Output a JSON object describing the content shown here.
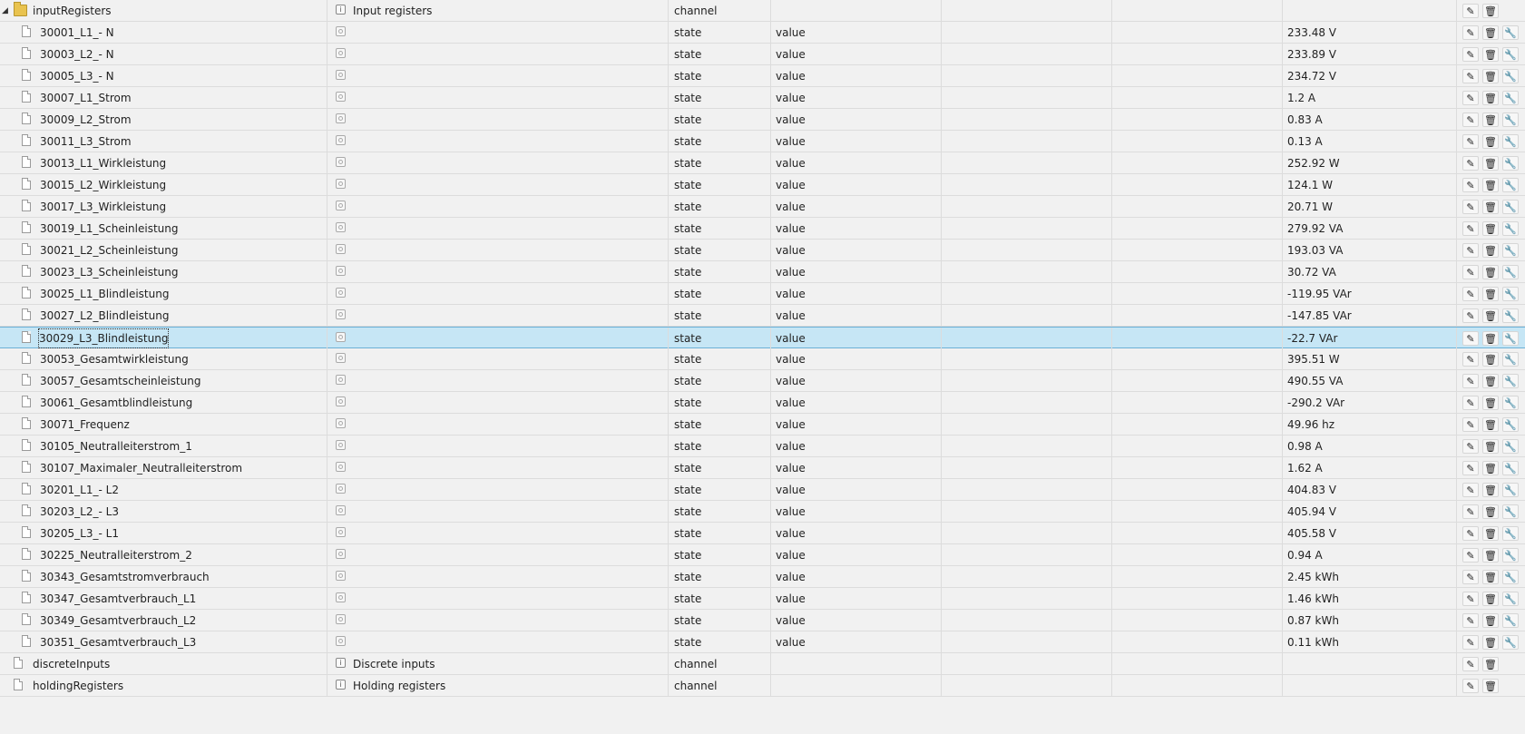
{
  "folder": {
    "name": "inputRegisters",
    "desc": "Input registers",
    "type": "channel"
  },
  "rows": [
    {
      "name": "30001_L1_- N",
      "type": "state",
      "role": "value",
      "val": "233.48 V"
    },
    {
      "name": "30003_L2_- N",
      "type": "state",
      "role": "value",
      "val": "233.89 V"
    },
    {
      "name": "30005_L3_- N",
      "type": "state",
      "role": "value",
      "val": "234.72 V"
    },
    {
      "name": "30007_L1_Strom",
      "type": "state",
      "role": "value",
      "val": "1.2 A"
    },
    {
      "name": "30009_L2_Strom",
      "type": "state",
      "role": "value",
      "val": "0.83 A"
    },
    {
      "name": "30011_L3_Strom",
      "type": "state",
      "role": "value",
      "val": "0.13 A"
    },
    {
      "name": "30013_L1_Wirkleistung",
      "type": "state",
      "role": "value",
      "val": "252.92 W"
    },
    {
      "name": "30015_L2_Wirkleistung",
      "type": "state",
      "role": "value",
      "val": "124.1 W"
    },
    {
      "name": "30017_L3_Wirkleistung",
      "type": "state",
      "role": "value",
      "val": "20.71 W"
    },
    {
      "name": "30019_L1_Scheinleistung",
      "type": "state",
      "role": "value",
      "val": "279.92 VA"
    },
    {
      "name": "30021_L2_Scheinleistung",
      "type": "state",
      "role": "value",
      "val": "193.03 VA"
    },
    {
      "name": "30023_L3_Scheinleistung",
      "type": "state",
      "role": "value",
      "val": "30.72 VA"
    },
    {
      "name": "30025_L1_Blindleistung",
      "type": "state",
      "role": "value",
      "val": "-119.95 VAr"
    },
    {
      "name": "30027_L2_Blindleistung",
      "type": "state",
      "role": "value",
      "val": "-147.85 VAr"
    },
    {
      "name": "30029_L3_Blindleistung",
      "type": "state",
      "role": "value",
      "val": "-22.7 VAr"
    },
    {
      "name": "30053_Gesamtwirkleistung",
      "type": "state",
      "role": "value",
      "val": "395.51 W"
    },
    {
      "name": "30057_Gesamtscheinleistung",
      "type": "state",
      "role": "value",
      "val": "490.55 VA"
    },
    {
      "name": "30061_Gesamtblindleistung",
      "type": "state",
      "role": "value",
      "val": "-290.2 VAr"
    },
    {
      "name": "30071_Frequenz",
      "type": "state",
      "role": "value",
      "val": "49.96 hz"
    },
    {
      "name": "30105_Neutralleiterstrom_1",
      "type": "state",
      "role": "value",
      "val": "0.98 A"
    },
    {
      "name": "30107_Maximaler_Neutralleiterstrom",
      "type": "state",
      "role": "value",
      "val": "1.62 A"
    },
    {
      "name": "30201_L1_- L2",
      "type": "state",
      "role": "value",
      "val": "404.83 V"
    },
    {
      "name": "30203_L2_- L3",
      "type": "state",
      "role": "value",
      "val": "405.94 V"
    },
    {
      "name": "30205_L3_- L1",
      "type": "state",
      "role": "value",
      "val": "405.58 V"
    },
    {
      "name": "30225_Neutralleiterstrom_2",
      "type": "state",
      "role": "value",
      "val": "0.94 A"
    },
    {
      "name": "30343_Gesamtstromverbrauch",
      "type": "state",
      "role": "value",
      "val": "2.45 kWh"
    },
    {
      "name": "30347_Gesamtverbrauch_L1",
      "type": "state",
      "role": "value",
      "val": "1.46 kWh"
    },
    {
      "name": "30349_Gesamtverbrauch_L2",
      "type": "state",
      "role": "value",
      "val": "0.87 kWh"
    },
    {
      "name": "30351_Gesamtverbrauch_L3",
      "type": "state",
      "role": "value",
      "val": "0.11 kWh"
    }
  ],
  "selected_index": 14,
  "channels": [
    {
      "name": "discreteInputs",
      "desc": "Discrete inputs",
      "type": "channel"
    },
    {
      "name": "holdingRegisters",
      "desc": "Holding registers",
      "type": "channel"
    }
  ],
  "icons": {
    "edit": "pencil-icon",
    "delete": "trash-icon",
    "custom": "wrench-icon",
    "expand": "collapse-arrow-icon"
  }
}
